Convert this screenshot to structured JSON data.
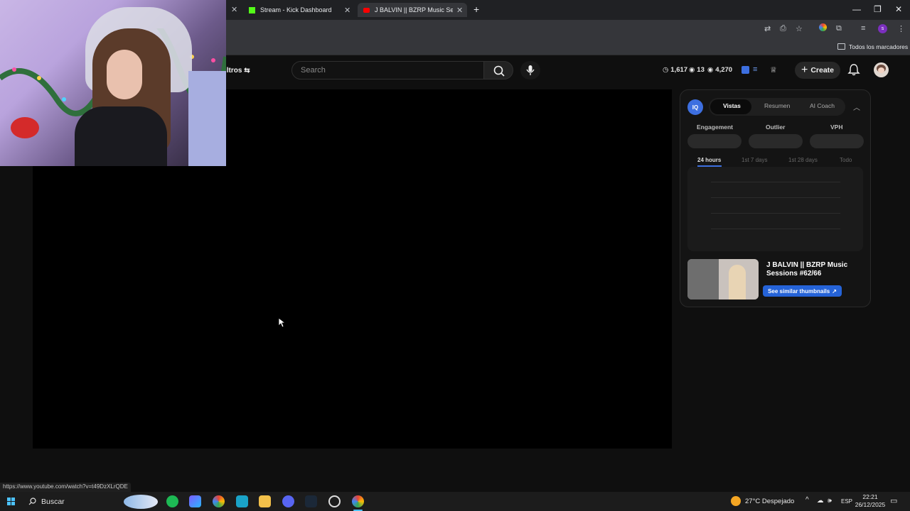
{
  "browser": {
    "tabs": [
      {
        "label": "Stream - Kick Dashboard",
        "active": false
      },
      {
        "label": "J BALVIN || BZRP Music Sessions",
        "active": true
      }
    ],
    "new_tab_symbol": "+",
    "bookmarks_label": "Todos los marcadores",
    "status_url": "https://www.youtube.com/watch?v=t49DzXLrQDE"
  },
  "header": {
    "filters_label": "iltros",
    "search_placeholder": "Search",
    "stats": [
      {
        "icon": "clock-icon",
        "value": "1,617"
      },
      {
        "icon": "eye-icon",
        "value": "13"
      },
      {
        "icon": "eye-icon",
        "value": "4,270"
      }
    ],
    "create_label": "Create"
  },
  "panel": {
    "badge": "IQ",
    "segments": [
      "Vistas",
      "Resumen",
      "AI Coach"
    ],
    "active_segment": "Vistas",
    "metrics": [
      "Engagement",
      "Outlier",
      "VPH"
    ],
    "ranges": [
      "24 hours",
      "1st 7 days",
      "1st 28 days",
      "Todo"
    ],
    "active_range": "24 hours",
    "video_title": "J BALVIN || BZRP Music Sessions #62/66",
    "similar_label": "See similar thumbnails",
    "accent_color": "#2563d8"
  },
  "taskbar": {
    "search_label": "Buscar",
    "weather": "27°C  Despejado",
    "language": "ESP",
    "time": "22:21",
    "date": "26/12/2025"
  }
}
